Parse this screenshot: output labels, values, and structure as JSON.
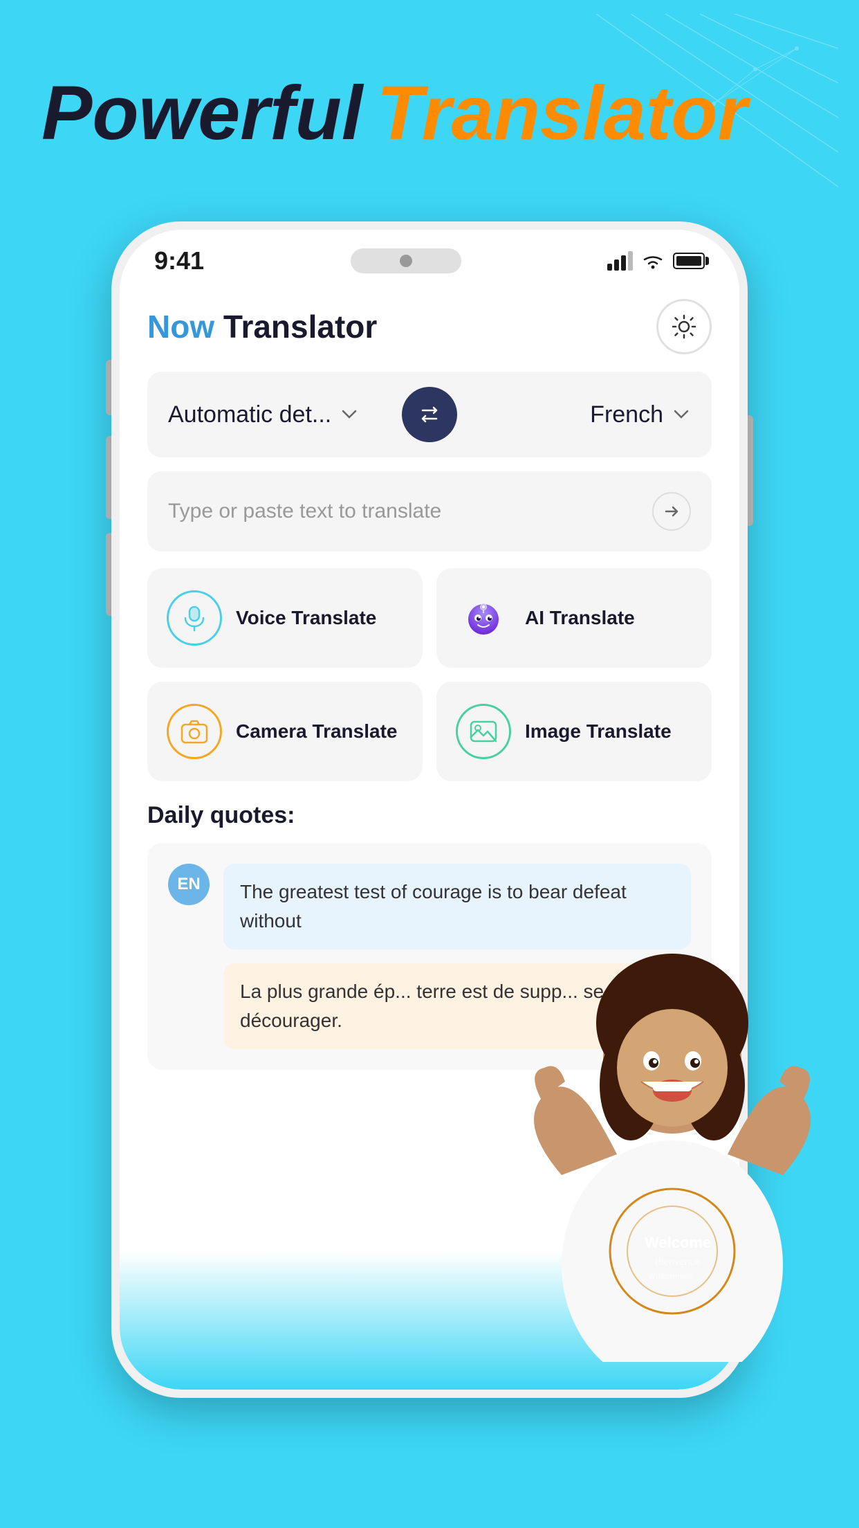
{
  "hero": {
    "powerful": "Powerful",
    "translator": "Translator"
  },
  "phone": {
    "status_time": "9:41",
    "app_title_now": "Now",
    "app_title_rest": " Translator"
  },
  "language_selector": {
    "source_lang": "Automatic det...",
    "target_lang": "French"
  },
  "text_input": {
    "placeholder": "Type or paste text to translate"
  },
  "features": [
    {
      "id": "voice",
      "label": "Voice Translate",
      "icon": "🎙️"
    },
    {
      "id": "ai",
      "label": "AI Translate",
      "icon": "🤖"
    },
    {
      "id": "camera",
      "label": "Camera Translate",
      "icon": "📷"
    },
    {
      "id": "image",
      "label": "Image Translate",
      "icon": "🖼️"
    }
  ],
  "daily_quotes": {
    "title": "Daily quotes:",
    "lang_badge": "EN",
    "quote_en": "The greatest test of courage is to bear defeat without",
    "quote_fr": "La plus grande ép... terre est de supp... se décourager."
  }
}
